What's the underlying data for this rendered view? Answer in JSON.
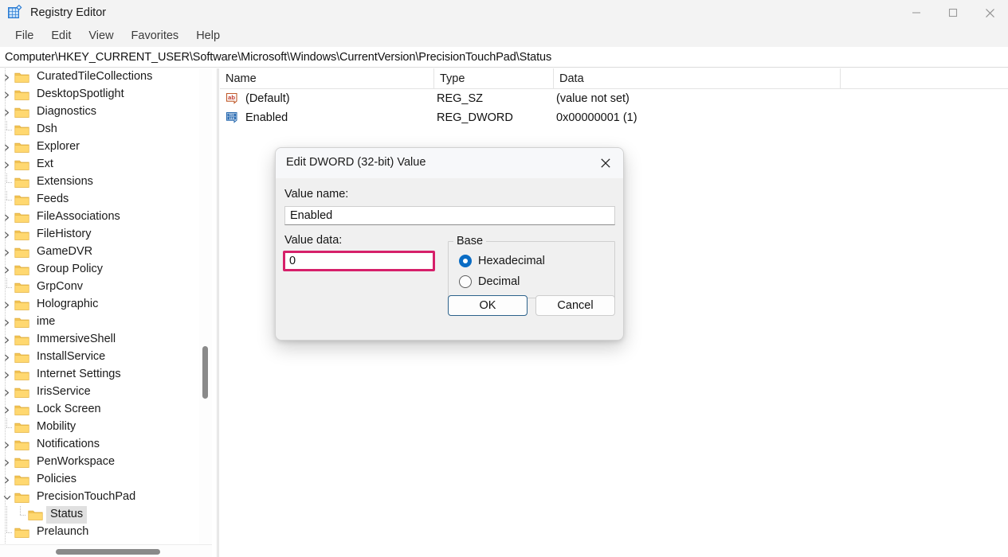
{
  "window": {
    "title": "Registry Editor",
    "app_icon": "registry-editor-icon",
    "controls": {
      "minimize": "minimize-icon",
      "maximize": "maximize-icon",
      "close": "close-icon"
    }
  },
  "menubar": {
    "items": [
      {
        "label": "File"
      },
      {
        "label": "Edit"
      },
      {
        "label": "View"
      },
      {
        "label": "Favorites"
      },
      {
        "label": "Help"
      }
    ]
  },
  "address": {
    "path": "Computer\\HKEY_CURRENT_USER\\Software\\Microsoft\\Windows\\CurrentVersion\\PrecisionTouchPad\\Status"
  },
  "tree": {
    "items": [
      {
        "label": "CuratedTileCollections",
        "expandable": true,
        "expanded": false,
        "depth": 1,
        "selected": false
      },
      {
        "label": "DesktopSpotlight",
        "expandable": true,
        "expanded": false,
        "depth": 1,
        "selected": false
      },
      {
        "label": "Diagnostics",
        "expandable": true,
        "expanded": false,
        "depth": 1,
        "selected": false
      },
      {
        "label": "Dsh",
        "expandable": false,
        "expanded": false,
        "depth": 1,
        "selected": false
      },
      {
        "label": "Explorer",
        "expandable": true,
        "expanded": false,
        "depth": 1,
        "selected": false
      },
      {
        "label": "Ext",
        "expandable": true,
        "expanded": false,
        "depth": 1,
        "selected": false
      },
      {
        "label": "Extensions",
        "expandable": false,
        "expanded": false,
        "depth": 1,
        "selected": false
      },
      {
        "label": "Feeds",
        "expandable": false,
        "expanded": false,
        "depth": 1,
        "selected": false
      },
      {
        "label": "FileAssociations",
        "expandable": true,
        "expanded": false,
        "depth": 1,
        "selected": false
      },
      {
        "label": "FileHistory",
        "expandable": true,
        "expanded": false,
        "depth": 1,
        "selected": false
      },
      {
        "label": "GameDVR",
        "expandable": true,
        "expanded": false,
        "depth": 1,
        "selected": false
      },
      {
        "label": "Group Policy",
        "expandable": true,
        "expanded": false,
        "depth": 1,
        "selected": false
      },
      {
        "label": "GrpConv",
        "expandable": false,
        "expanded": false,
        "depth": 1,
        "selected": false
      },
      {
        "label": "Holographic",
        "expandable": true,
        "expanded": false,
        "depth": 1,
        "selected": false
      },
      {
        "label": "ime",
        "expandable": true,
        "expanded": false,
        "depth": 1,
        "selected": false
      },
      {
        "label": "ImmersiveShell",
        "expandable": true,
        "expanded": false,
        "depth": 1,
        "selected": false
      },
      {
        "label": "InstallService",
        "expandable": true,
        "expanded": false,
        "depth": 1,
        "selected": false
      },
      {
        "label": "Internet Settings",
        "expandable": true,
        "expanded": false,
        "depth": 1,
        "selected": false
      },
      {
        "label": "IrisService",
        "expandable": true,
        "expanded": false,
        "depth": 1,
        "selected": false
      },
      {
        "label": "Lock Screen",
        "expandable": true,
        "expanded": false,
        "depth": 1,
        "selected": false
      },
      {
        "label": "Mobility",
        "expandable": false,
        "expanded": false,
        "depth": 1,
        "selected": false
      },
      {
        "label": "Notifications",
        "expandable": true,
        "expanded": false,
        "depth": 1,
        "selected": false
      },
      {
        "label": "PenWorkspace",
        "expandable": true,
        "expanded": false,
        "depth": 1,
        "selected": false
      },
      {
        "label": "Policies",
        "expandable": true,
        "expanded": false,
        "depth": 1,
        "selected": false
      },
      {
        "label": "PrecisionTouchPad",
        "expandable": true,
        "expanded": true,
        "depth": 1,
        "selected": false
      },
      {
        "label": "Status",
        "expandable": false,
        "expanded": false,
        "depth": 2,
        "selected": true
      },
      {
        "label": "Prelaunch",
        "expandable": false,
        "expanded": false,
        "depth": 1,
        "selected": false
      }
    ]
  },
  "list": {
    "columns": [
      {
        "label": "Name"
      },
      {
        "label": "Type"
      },
      {
        "label": "Data"
      }
    ],
    "rows": [
      {
        "icon": "string-value-icon",
        "name": "(Default)",
        "type": "REG_SZ",
        "data": "(value not set)"
      },
      {
        "icon": "dword-value-icon",
        "name": "Enabled",
        "type": "REG_DWORD",
        "data": "0x00000001 (1)"
      }
    ]
  },
  "dialog": {
    "title": "Edit DWORD (32-bit) Value",
    "close_icon": "close-icon",
    "value_name_label": "Value name:",
    "value_name": "Enabled",
    "value_data_label": "Value data:",
    "value_data": "0",
    "base_group_label": "Base",
    "base_options": [
      {
        "label": "Hexadecimal",
        "selected": true
      },
      {
        "label": "Decimal",
        "selected": false
      }
    ],
    "ok_label": "OK",
    "cancel_label": "Cancel",
    "highlight_color": "#D6206A"
  }
}
